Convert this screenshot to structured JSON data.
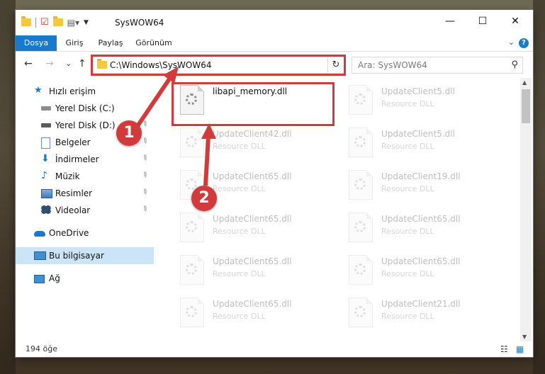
{
  "window": {
    "title": "SysWOW64",
    "controls": {
      "minimize": "—",
      "maximize": "☐",
      "close": "✕"
    }
  },
  "ribbon": {
    "tabs": [
      "Dosya",
      "Giriş",
      "Paylaş",
      "Görünüm"
    ],
    "active_tab": "Dosya",
    "toggle": "⌄",
    "help": "?"
  },
  "navigation": {
    "back": "←",
    "forward": "→",
    "recent": "⌄",
    "up": "↑",
    "address": "C:\\Windows\\SysWOW64",
    "address_dropdown": "⌄",
    "refresh": "↻",
    "search_placeholder": "Ara: SysWOW64",
    "search_icon": "⚲"
  },
  "sidebar": {
    "items": [
      {
        "label": "Hızlı erişim",
        "icon": "star-icon",
        "pinned": false,
        "selected": false
      },
      {
        "label": "Yerel Disk (C:)",
        "icon": "drive-icon",
        "pinned": false,
        "selected": false
      },
      {
        "label": "Yerel Disk (D:)",
        "icon": "drive-icon",
        "pinned": true,
        "selected": false
      },
      {
        "label": "Belgeler",
        "icon": "documents-icon",
        "pinned": true,
        "selected": false
      },
      {
        "label": "İndirmeler",
        "icon": "download-icon",
        "pinned": true,
        "selected": false
      },
      {
        "label": "Müzik",
        "icon": "music-icon",
        "pinned": true,
        "selected": false
      },
      {
        "label": "Resimler",
        "icon": "pictures-icon",
        "pinned": true,
        "selected": false
      },
      {
        "label": "Videolar",
        "icon": "videos-icon",
        "pinned": true,
        "selected": false
      },
      {
        "label": "OneDrive",
        "icon": "cloud-icon",
        "pinned": false,
        "selected": false
      },
      {
        "label": "Bu bilgisayar",
        "icon": "computer-icon",
        "pinned": false,
        "selected": true
      },
      {
        "label": "Ağ",
        "icon": "network-icon",
        "pinned": false,
        "selected": false
      }
    ],
    "pin_glyph": "📌"
  },
  "files": [
    {
      "name": "libapi_memory.dll",
      "type": "",
      "faded": false
    },
    {
      "name": "UpdateClient5.dll",
      "type": "Resource DLL",
      "faded": true
    },
    {
      "name": "UpdateClient42.dll",
      "type": "Resource DLL",
      "faded": true
    },
    {
      "name": "UpdateClient5.dll",
      "type": "Resource DLL",
      "faded": true
    },
    {
      "name": "UpdateClient65.dll",
      "type": "Resource DLL",
      "faded": true
    },
    {
      "name": "UpdateClient19.dll",
      "type": "Resource DLL",
      "faded": true
    },
    {
      "name": "UpdateClient65.dll",
      "type": "Resource DLL",
      "faded": true
    },
    {
      "name": "UpdateClient65.dll",
      "type": "Resource DLL",
      "faded": true
    },
    {
      "name": "UpdateClient65.dll",
      "type": "Resource DLL",
      "faded": true
    },
    {
      "name": "UpdateClient65.dll",
      "type": "Resource DLL",
      "faded": true
    },
    {
      "name": "UpdateClient65.dll",
      "type": "Resource DLL",
      "faded": true
    },
    {
      "name": "UpdateClient21.dll",
      "type": "Resource DLL",
      "faded": true
    }
  ],
  "status": {
    "item_count": "194 öğe",
    "details_view_icon": "☷",
    "large_icons_view_icon": "▦"
  },
  "annotations": {
    "callout_1": "1",
    "callout_2": "2",
    "color": "#d23b3b"
  },
  "colors": {
    "accent": "#1979ca",
    "selection": "#cce4f7",
    "folder": "#f5c842"
  }
}
